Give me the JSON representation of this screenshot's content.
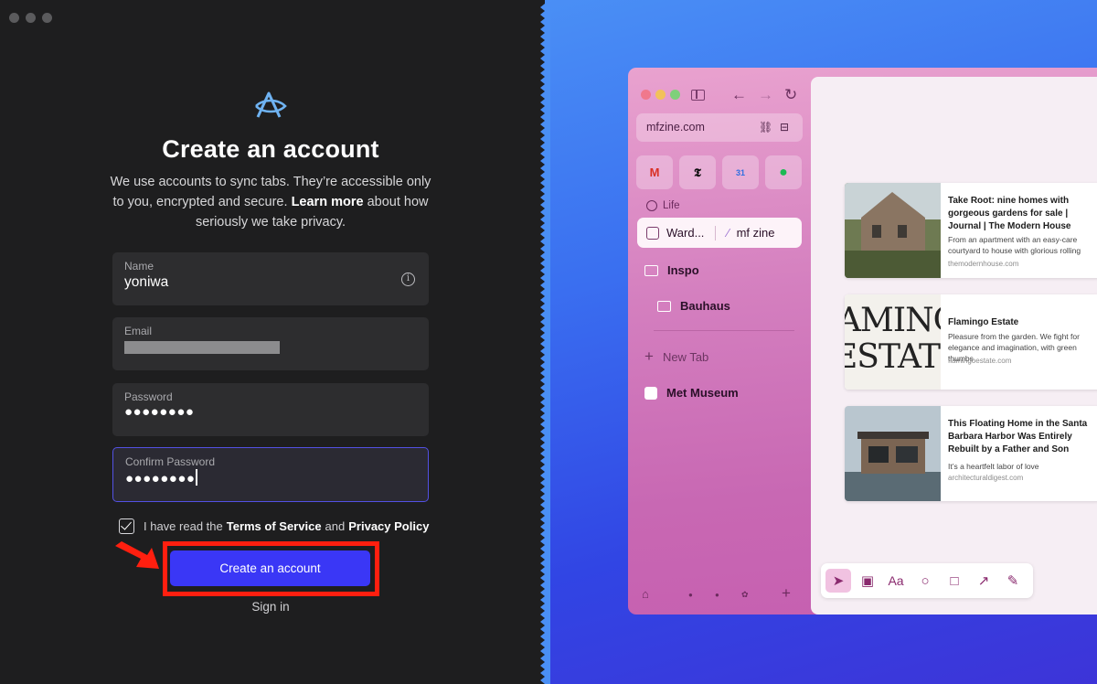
{
  "left": {
    "title": "Create an account",
    "subtitle_part1": "We use accounts to sync tabs. They’re accessible only to you, encrypted and secure. ",
    "subtitle_link": "Learn more",
    "subtitle_part2": " about how seriously we take privacy.",
    "fields": {
      "name_label": "Name",
      "name_value": "yoniwa",
      "email_label": "Email",
      "password_label": "Password",
      "password_value": "●●●●●●●●",
      "confirm_label": "Confirm Password",
      "confirm_value": "●●●●●●●●"
    },
    "terms_prefix": "I have read the",
    "terms_tos": "Terms of Service",
    "terms_and": "and",
    "terms_privacy": "Privacy Policy",
    "create_button": "Create an account",
    "sign_in": "Sign in",
    "accent_color": "#3a37f6",
    "highlight_color": "#ff1f0f"
  },
  "browser": {
    "url": "mfzine.com",
    "favorites": [
      "gmail-icon",
      "nyt-icon",
      "calendar-icon",
      "spotify-icon"
    ],
    "favorites_labels": [
      "M",
      "𝕿",
      "31",
      "●"
    ],
    "section_label": "Life",
    "split_tab_left": "Ward...",
    "split_tab_right": "mf zine",
    "folder_1": "Inspo",
    "folder_2": "Bauhaus",
    "new_tab": "New Tab",
    "met_museum": "Met Museum",
    "cards": [
      {
        "title": "Take Root: nine homes with gorgeous gardens for sale | Journal | The Modern House",
        "description": "From an apartment with an easy-care courtyard to house with glorious rolling",
        "domain": "themodernhouse.com"
      },
      {
        "title": "Flamingo Estate",
        "description": "Pleasure from the garden. We fight for elegance and imagination, with green thumbs",
        "domain": "flamingoestate.com",
        "thumb_text_1": "AMING",
        "thumb_text_2": "ESTATE"
      },
      {
        "title": "This Floating Home in the Santa Barbara Harbor Was Entirely Rebuilt by a Father and Son",
        "description": "It’s a heartfelt labor of love",
        "domain": "architecturaldigest.com"
      }
    ],
    "tools": [
      "pointer-tool-icon",
      "image-tool-icon",
      "text-tool-icon",
      "circle-tool-icon",
      "square-tool-icon",
      "arrow-tool-icon",
      "pen-tool-icon"
    ],
    "text_tool_label": "Aa"
  }
}
